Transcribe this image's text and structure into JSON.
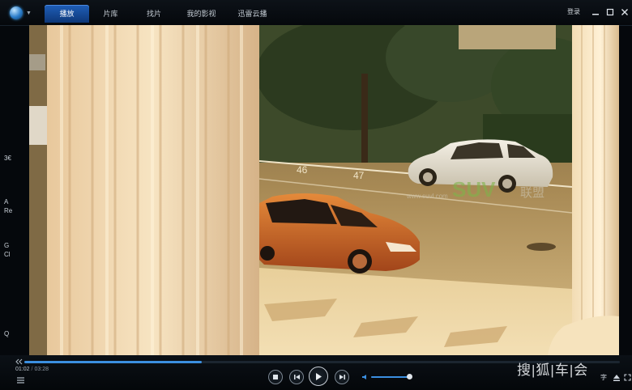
{
  "app": {
    "tabs": [
      {
        "label": "播放",
        "active": true
      },
      {
        "label": "片库",
        "active": false
      },
      {
        "label": "找片",
        "active": false
      },
      {
        "label": "我的影视",
        "active": false
      },
      {
        "label": "迅雷云播",
        "active": false
      }
    ],
    "login_label": "登录",
    "window_controls": [
      "minimize-icon",
      "maximize-icon",
      "close-icon"
    ],
    "accent_color": "#1f5fb8"
  },
  "playlist_sliver": {
    "fragments": [
      "3€",
      "A",
      "Re",
      "G",
      "Cl",
      "Q",
      "Q"
    ]
  },
  "player": {
    "elapsed": "01:02",
    "separator": "/",
    "duration": "03:28",
    "progress_percent": 29.8,
    "volume_percent": 100,
    "progress_color": "#3b8fe0"
  },
  "video": {
    "watermark_url": "www.suvl.com",
    "watermark_logo": "SUV",
    "watermark_suffix": "联盟",
    "parking_marks": [
      "46",
      "47"
    ]
  },
  "overlay_watermark": "搜|狐|车|会",
  "right_buttons": {
    "subtitle_label": "字"
  }
}
